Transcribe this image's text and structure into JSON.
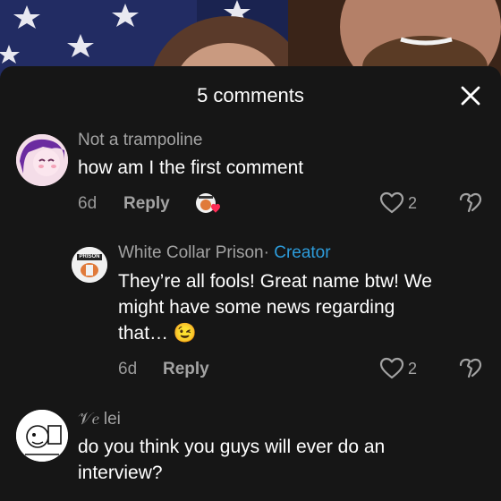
{
  "sheet": {
    "title": "5 comments"
  },
  "comments": [
    {
      "username": "Not a trampoline",
      "text": "how am I the first comment",
      "date": "6d",
      "reply_label": "Reply",
      "likes": "2"
    },
    {
      "username": "White Collar Prison",
      "separator": "·",
      "creator_label": "Creator",
      "text_line1": "They’re all fools! Great name btw! We",
      "text_line2": "might have some news regarding",
      "text_line3": "that… 😉",
      "date": "6d",
      "reply_label": "Reply",
      "likes": "2",
      "avatar_text": "PRISON"
    },
    {
      "username": "𝒱𝑒  lei",
      "text_line1": "do you think you guys will ever do an",
      "text_line2": "interview?"
    }
  ],
  "colors": {
    "accent": "#2d9cdb",
    "sheet_bg": "#161616"
  }
}
